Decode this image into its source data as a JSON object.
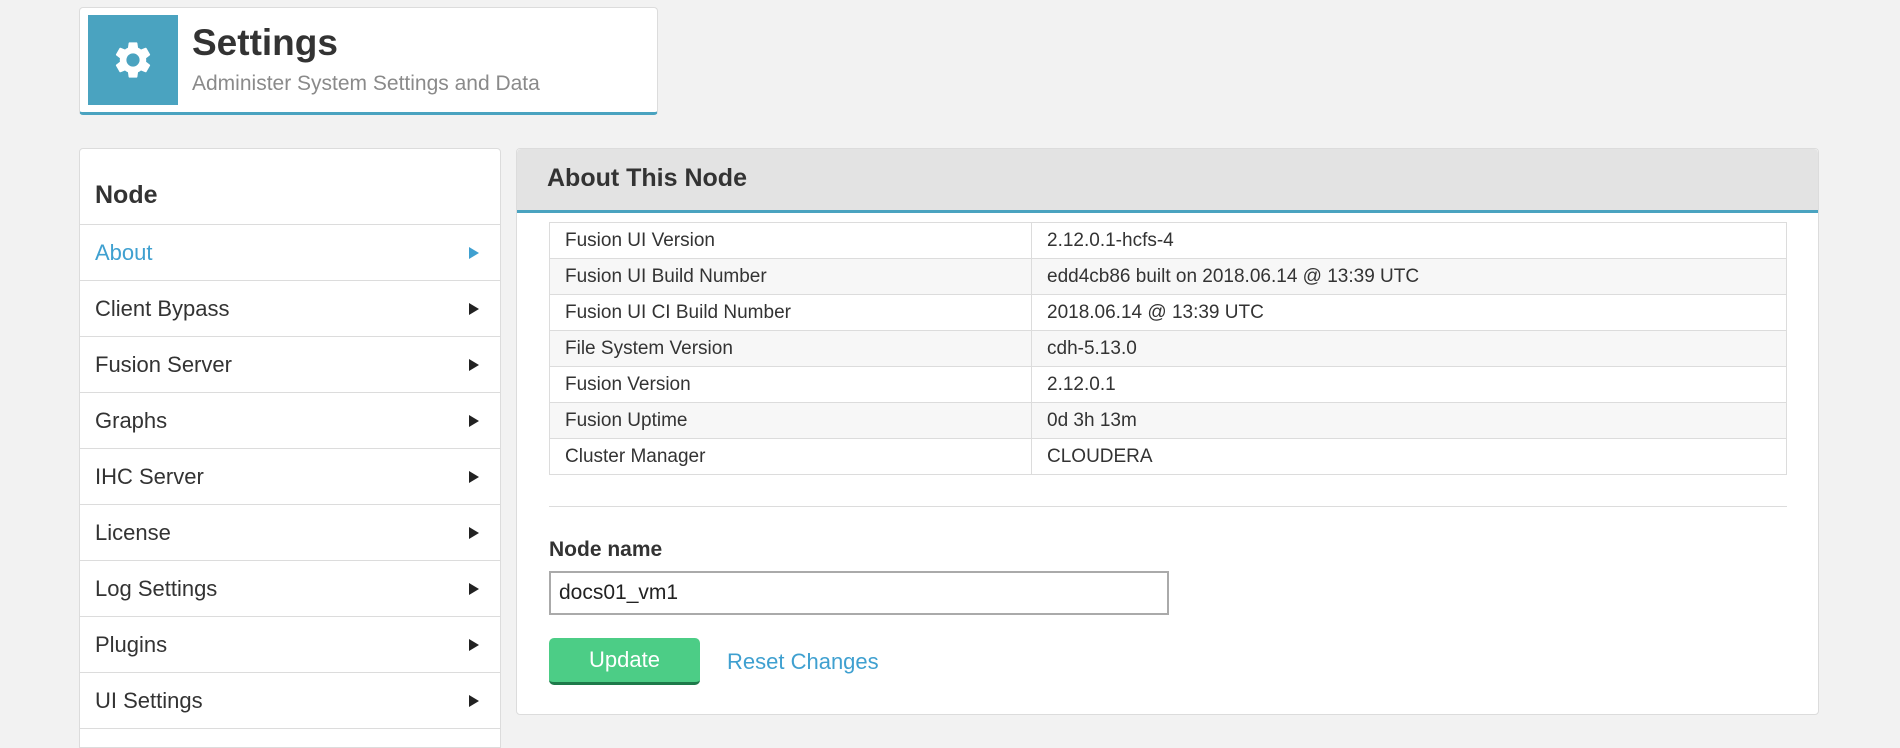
{
  "header": {
    "title": "Settings",
    "subtitle": "Administer System Settings and Data",
    "icon": "gear-icon",
    "accent_color": "#4aa3c0"
  },
  "sidebar": {
    "heading": "Node",
    "items": [
      {
        "label": "About",
        "active": true
      },
      {
        "label": "Client Bypass"
      },
      {
        "label": "Fusion Server"
      },
      {
        "label": "Graphs"
      },
      {
        "label": "IHC Server"
      },
      {
        "label": "License"
      },
      {
        "label": "Log Settings"
      },
      {
        "label": "Plugins"
      },
      {
        "label": "UI Settings"
      }
    ]
  },
  "main": {
    "title": "About This Node",
    "table": [
      {
        "label": "Fusion UI Version",
        "value": "2.12.0.1-hcfs-4"
      },
      {
        "label": "Fusion UI Build Number",
        "value": "edd4cb86 built on 2018.06.14 @ 13:39 UTC"
      },
      {
        "label": "Fusion UI CI Build Number",
        "value": "2018.06.14 @ 13:39 UTC"
      },
      {
        "label": "File System Version",
        "value": "cdh-5.13.0"
      },
      {
        "label": "Fusion Version",
        "value": "2.12.0.1"
      },
      {
        "label": "Fusion Uptime",
        "value": "0d 3h 13m"
      },
      {
        "label": "Cluster Manager",
        "value": "CLOUDERA"
      }
    ],
    "node_name_label": "Node name",
    "node_name_value": "docs01_vm1",
    "update_label": "Update",
    "reset_label": "Reset Changes"
  }
}
